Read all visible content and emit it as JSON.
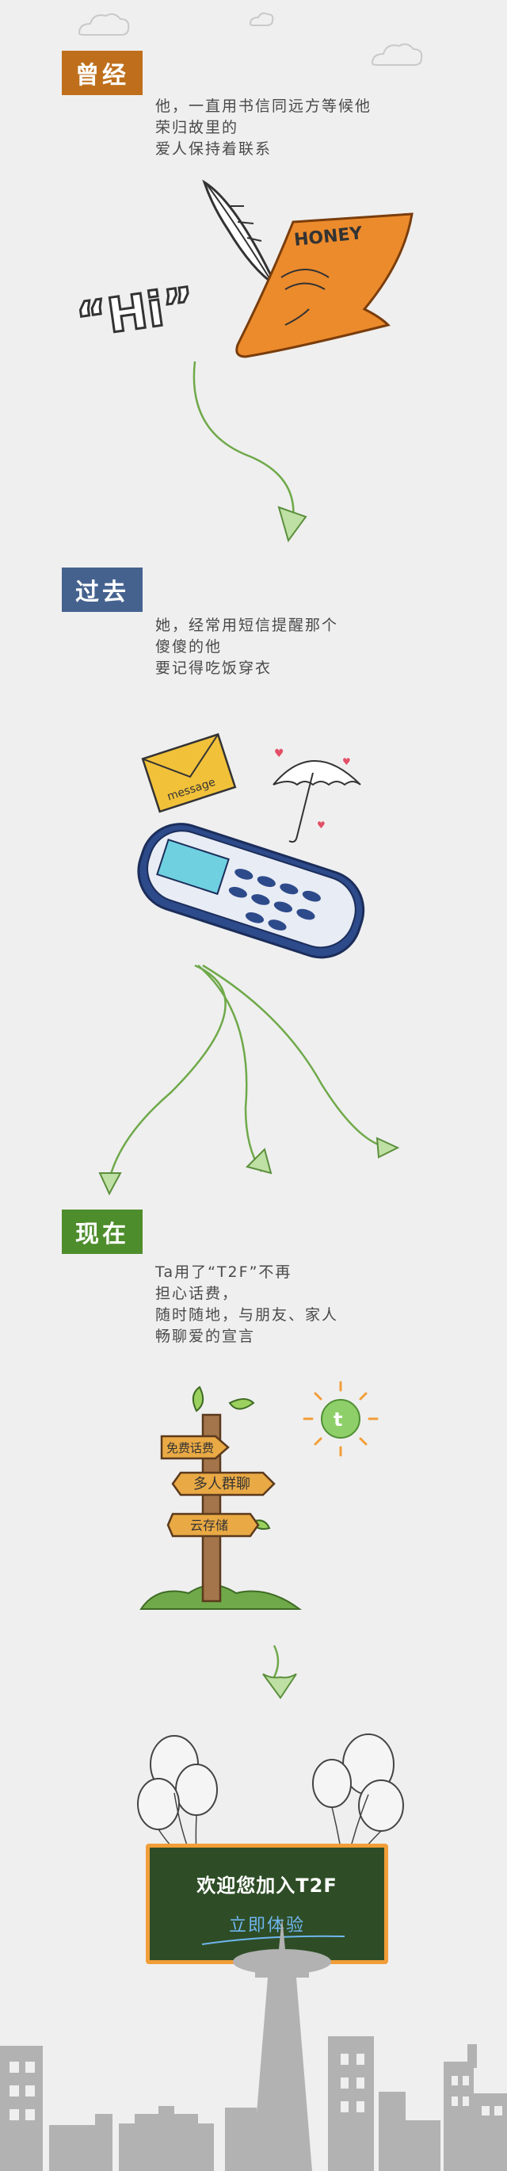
{
  "sections": [
    {
      "badge": "曾经",
      "badge_color": "#bf6f1b",
      "lines": [
        "他，一直用书信同远方等候他",
        "荣归故里的",
        "爱人保持着联系"
      ]
    },
    {
      "badge": "过去",
      "badge_color": "#45628f",
      "lines": [
        "她，经常用短信提醒那个",
        "傻傻的他",
        "要记得吃饭穿衣"
      ]
    },
    {
      "badge": "现在",
      "badge_color": "#4e8d2c",
      "lines": [
        "Ta用了“T2F”不再",
        "担心话费，",
        "随时随地，与朋友、家人",
        "畅聊爱的宣言"
      ]
    }
  ],
  "illustrations": {
    "hi_text": "“Hi”",
    "honey_text": "HONEY",
    "message_text": "message",
    "signpost": [
      "免费话费",
      "多人群聊",
      "云存储"
    ],
    "logo_letter": "t"
  },
  "cta": {
    "title": "欢迎您加入T2F",
    "button": "立即体验",
    "board_color": "#2e4d26",
    "frame_color": "#f29e38"
  }
}
